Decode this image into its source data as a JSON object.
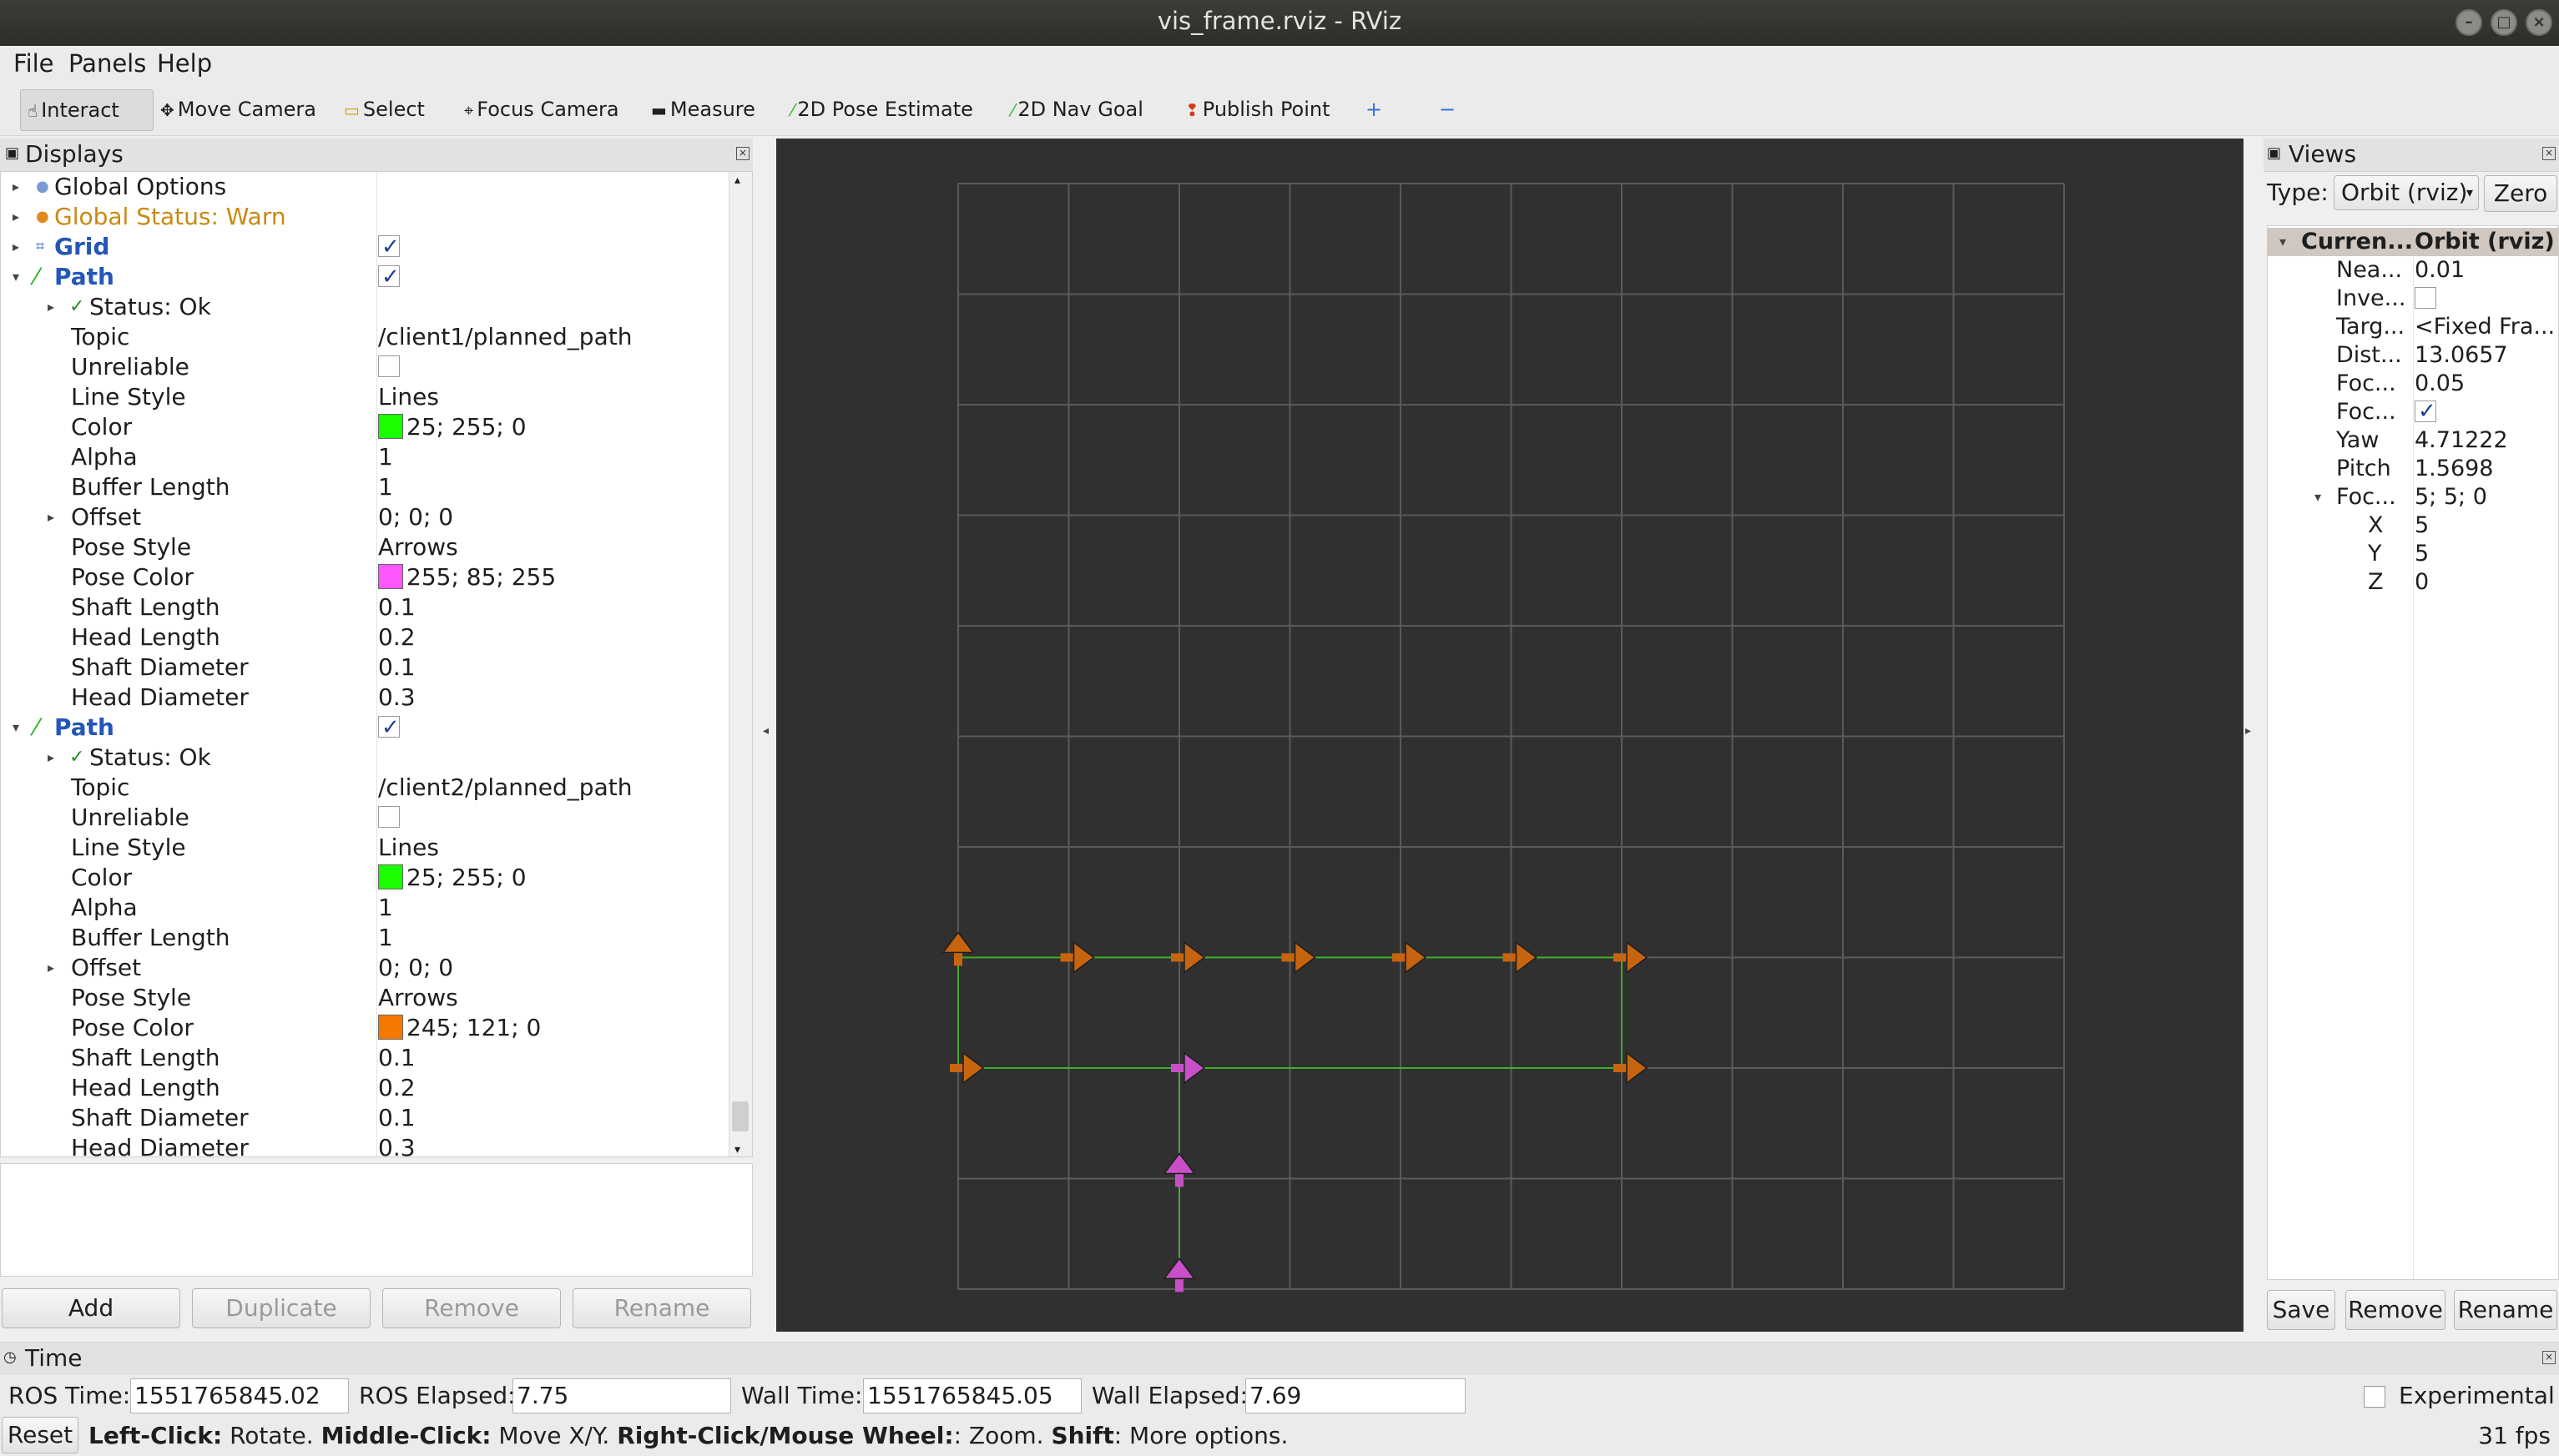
{
  "window": {
    "title": "vis_frame.rviz - RViz"
  },
  "menu": {
    "file": "File",
    "panels": "Panels",
    "help": "Help"
  },
  "toolbar": {
    "interact": "Interact",
    "move_camera": "Move Camera",
    "select": "Select",
    "focus_camera": "Focus Camera",
    "measure": "Measure",
    "pose_estimate": "2D Pose Estimate",
    "nav_goal": "2D Nav Goal",
    "publish_point": "Publish Point",
    "add_tool": "+",
    "remove_tool": "−"
  },
  "displays": {
    "header": "Displays",
    "global_options": "Global Options",
    "global_status": "Global Status: Warn",
    "grid": "Grid",
    "grid_enabled": true,
    "paths": [
      {
        "name": "Path",
        "enabled": true,
        "status": "Status: Ok",
        "topic": "/client1/planned_path",
        "unreliable": false,
        "line_style": "Lines",
        "color_hex": "#19ff00",
        "color": "25; 255; 0",
        "alpha": "1",
        "buffer_length": "1",
        "offset": "0; 0; 0",
        "pose_style": "Arrows",
        "pose_color_hex": "#ff55ff",
        "pose_color": "255; 85; 255",
        "shaft_length": "0.1",
        "head_length": "0.2",
        "shaft_diameter": "0.1",
        "head_diameter": "0.3"
      },
      {
        "name": "Path",
        "enabled": true,
        "status": "Status: Ok",
        "topic": "/client2/planned_path",
        "unreliable": false,
        "line_style": "Lines",
        "color_hex": "#19ff00",
        "color": "25; 255; 0",
        "alpha": "1",
        "buffer_length": "1",
        "offset": "0; 0; 0",
        "pose_style": "Arrows",
        "pose_color_hex": "#f57900",
        "pose_color": "245; 121; 0",
        "shaft_length": "0.1",
        "head_length": "0.2",
        "shaft_diameter": "0.1",
        "head_diameter": "0.3"
      }
    ],
    "labels": {
      "topic": "Topic",
      "unreliable": "Unreliable",
      "line_style": "Line Style",
      "color": "Color",
      "alpha": "Alpha",
      "buffer_length": "Buffer Length",
      "offset": "Offset",
      "pose_style": "Pose Style",
      "pose_color": "Pose Color",
      "shaft_length": "Shaft Length",
      "head_length": "Head Length",
      "shaft_diameter": "Shaft Diameter",
      "head_diameter": "Head Diameter"
    },
    "buttons": {
      "add": "Add",
      "duplicate": "Duplicate",
      "remove": "Remove",
      "rename": "Rename"
    }
  },
  "views": {
    "header": "Views",
    "type_label": "Type:",
    "type_value": "Orbit (rviz)",
    "zero": "Zero",
    "current_label": "Curren...",
    "current_value": "Orbit (rviz)",
    "props": [
      {
        "label": "Nea...",
        "value": "0.01"
      },
      {
        "label": "Inve...",
        "value": ""
      },
      {
        "label": "Targ...",
        "value": "<Fixed Fra..."
      },
      {
        "label": "Dist...",
        "value": "13.0657"
      },
      {
        "label": "Foc...",
        "value": "0.05"
      },
      {
        "label": "Foc...",
        "value": ""
      },
      {
        "label": "Yaw",
        "value": "4.71222"
      },
      {
        "label": "Pitch",
        "value": "1.5698"
      },
      {
        "label": "Foc...",
        "value": "5; 5; 0"
      },
      {
        "label": "X",
        "value": "5"
      },
      {
        "label": "Y",
        "value": "5"
      },
      {
        "label": "Z",
        "value": "0"
      }
    ],
    "buttons": {
      "save": "Save",
      "remove": "Remove",
      "rename": "Rename"
    }
  },
  "time": {
    "header": "Time",
    "ros_time_label": "ROS Time:",
    "ros_time": "1551765845.02",
    "ros_elapsed_label": "ROS Elapsed:",
    "ros_elapsed": "7.75",
    "wall_time_label": "Wall Time:",
    "wall_time": "1551765845.05",
    "wall_elapsed_label": "Wall Elapsed:",
    "wall_elapsed": "7.69",
    "experimental": "Experimental"
  },
  "status": {
    "reset": "Reset",
    "left_click": "Left-Click:",
    "left_click_desc": " Rotate. ",
    "middle_click": "Middle-Click:",
    "middle_click_desc": " Move X/Y. ",
    "right_click": "Right-Click/Mouse Wheel:",
    "right_click_desc": ": Zoom. ",
    "shift": "Shift",
    "shift_desc": ": More options.",
    "fps": "31 fps"
  },
  "scene": {
    "grid_color": "#5a5a5a",
    "path_line_color": "#3fae2c",
    "client1_arrow_color": "#c94fc9",
    "client2_arrow_color": "#c7640f"
  }
}
